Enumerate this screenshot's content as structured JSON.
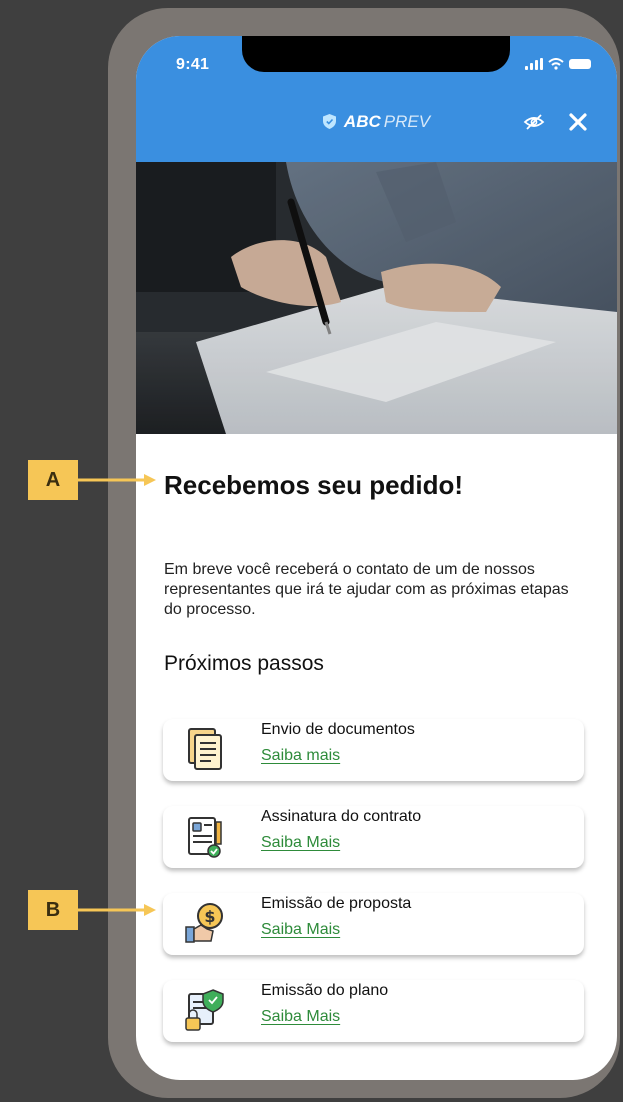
{
  "status_bar": {
    "time": "9:41"
  },
  "header": {
    "brand_bold": "ABC",
    "brand_light": "PREV"
  },
  "content": {
    "title": "Recebemos seu pedido!",
    "description": "Em breve você receberá o contato de um de nossos representantes que irá te ajudar com as próximas etapas do processo.",
    "steps_title": "Próximos passos",
    "steps": [
      {
        "label": "Envio de documentos",
        "link": "Saiba mais",
        "icon": "documents-icon"
      },
      {
        "label": "Assinatura do contrato",
        "link": "Saiba Mais",
        "icon": "contract-signature-icon"
      },
      {
        "label": "Emissão de proposta",
        "link": "Saiba Mais",
        "icon": "money-proposal-icon"
      },
      {
        "label": "Emissão do plano",
        "link": "Saiba Mais",
        "icon": "secure-plan-icon"
      }
    ]
  },
  "annotations": {
    "a": "A",
    "b": "B"
  },
  "colors": {
    "header_blue": "#3a8fe0",
    "link_green": "#2e8b3a",
    "callout_yellow": "#f6c656",
    "frame": "#7b7672"
  }
}
